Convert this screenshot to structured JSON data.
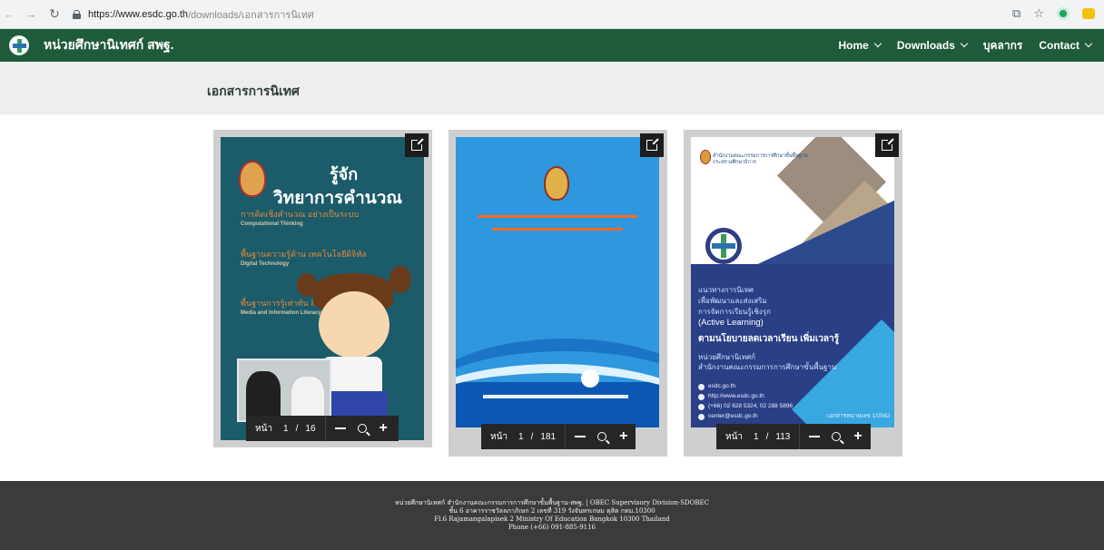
{
  "browser": {
    "url_host": "https://www.esdc.go.th",
    "url_path": "/downloads/เอกสารการนิเทศ"
  },
  "site": {
    "title": "หน่วยศึกษานิเทศก์ สพฐ.",
    "menu": [
      {
        "label": "Home",
        "has_dropdown": true
      },
      {
        "label": "Downloads",
        "has_dropdown": true
      },
      {
        "label": "บุคลากร",
        "has_dropdown": false
      },
      {
        "label": "Contact",
        "has_dropdown": true
      }
    ]
  },
  "page": {
    "title": "เอกสารการนิเทศ"
  },
  "documents": [
    {
      "pager_label": "หน้า",
      "page_current": "1",
      "separator": "/",
      "page_total": "16",
      "cover": {
        "title_line1": "รู้จัก",
        "title_line2": "วิทยาการคำนวณ",
        "tags": [
          {
            "th": "การคิดเชิงคำนวณ อย่างเป็นระบบ",
            "en": "Computational Thinking"
          },
          {
            "th": "พื้นฐานความรู้ด้าน เทคโนโลยีดิจิทัล",
            "en": "Digital Technology"
          },
          {
            "th": "พื้นฐานการรู้เท่าทัน สื่อและสารสนเทศ",
            "en": "Media and Information Literacy"
          }
        ]
      }
    },
    {
      "pager_label": "หน้า",
      "page_current": "1",
      "separator": "/",
      "page_total": "181",
      "cover": {}
    },
    {
      "pager_label": "หน้า",
      "page_current": "1",
      "separator": "/",
      "page_total": "113",
      "cover": {
        "header_line1": "สำนักงานคณะกรรมการการศึกษาขั้นพื้นฐาน",
        "header_line2": "กระทรวงศึกษาธิการ",
        "line1": "แนวทางการนิเทศ",
        "line2": "เพื่อพัฒนาและส่งเสริม",
        "line3": "การจัดการเรียนรู้เชิงรุก",
        "line4": "(Active Learning)",
        "line5": "ตามนโยบายลดเวลาเรียน เพิ่มเวลารู้",
        "org1": "หน่วยศึกษานิเทศก์",
        "org2": "สำนักงานคณะกรรมการการศึกษาขั้นพื้นฐาน",
        "contacts": [
          "esdc.go.th",
          "http://www.esdc.go.th",
          "(+66) 02 628 5324, 02 288 5896",
          "center@esdc.go.th"
        ],
        "doc_no": "เอกสารหมายเลข 1/2562"
      }
    }
  ],
  "footer": {
    "line1": "หน่วยศึกษานิเทศก์ สำนักงานคณะกรรมการการศึกษาขั้นพื้นฐาน-สพฐ. | OBEC Supervisory Division-SDOBEC",
    "line2": "ชั้น 6 อาคารราชวัลลภาภิเษก 2 เลขที่ 319 วังจันทรเกษม ดุสิต กทม.10300",
    "line3": "Fl.6 Rajamangalapisek 2 Ministry Of Education Bangkok 10300 Thailand",
    "line4": "Phone (+66) 091-885-9116"
  },
  "colors": {
    "header_green": "#1f5a3a",
    "footer_dark": "#3b3b3b",
    "title_band": "#eeeeee"
  }
}
